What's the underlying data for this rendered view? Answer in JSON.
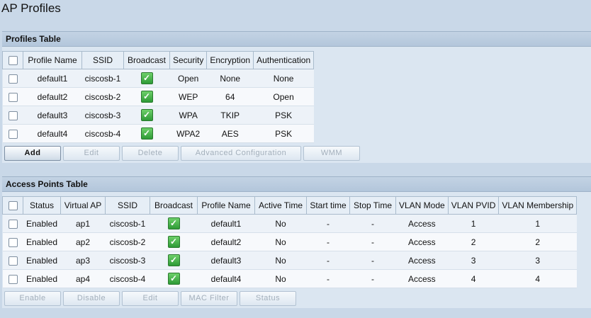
{
  "page_title": "AP Profiles",
  "profiles": {
    "title": "Profiles Table",
    "columns": [
      "Profile Name",
      "SSID",
      "Broadcast",
      "Security",
      "Encryption",
      "Authentication"
    ],
    "rows": [
      {
        "name": "default1",
        "ssid": "ciscosb-1",
        "broadcast": true,
        "security": "Open",
        "encryption": "None",
        "authentication": "None"
      },
      {
        "name": "default2",
        "ssid": "ciscosb-2",
        "broadcast": true,
        "security": "WEP",
        "encryption": "64",
        "authentication": "Open"
      },
      {
        "name": "default3",
        "ssid": "ciscosb-3",
        "broadcast": true,
        "security": "WPA",
        "encryption": "TKIP",
        "authentication": "PSK"
      },
      {
        "name": "default4",
        "ssid": "ciscosb-4",
        "broadcast": true,
        "security": "WPA2",
        "encryption": "AES",
        "authentication": "PSK"
      }
    ],
    "buttons": {
      "add": "Add",
      "edit": "Edit",
      "delete": "Delete",
      "advanced": "Advanced Configuration",
      "wmm": "WMM"
    }
  },
  "access_points": {
    "title": "Access Points Table",
    "columns": [
      "Status",
      "Virtual AP",
      "SSID",
      "Broadcast",
      "Profile Name",
      "Active Time",
      "Start time",
      "Stop Time",
      "VLAN Mode",
      "VLAN PVID",
      "VLAN Membership"
    ],
    "rows": [
      {
        "status": "Enabled",
        "vap": "ap1",
        "ssid": "ciscosb-1",
        "broadcast": true,
        "profile": "default1",
        "active": "No",
        "start": "-",
        "stop": "-",
        "vlan_mode": "Access",
        "pvid": "1",
        "membership": "1"
      },
      {
        "status": "Enabled",
        "vap": "ap2",
        "ssid": "ciscosb-2",
        "broadcast": true,
        "profile": "default2",
        "active": "No",
        "start": "-",
        "stop": "-",
        "vlan_mode": "Access",
        "pvid": "2",
        "membership": "2"
      },
      {
        "status": "Enabled",
        "vap": "ap3",
        "ssid": "ciscosb-3",
        "broadcast": true,
        "profile": "default3",
        "active": "No",
        "start": "-",
        "stop": "-",
        "vlan_mode": "Access",
        "pvid": "3",
        "membership": "3"
      },
      {
        "status": "Enabled",
        "vap": "ap4",
        "ssid": "ciscosb-4",
        "broadcast": true,
        "profile": "default4",
        "active": "No",
        "start": "-",
        "stop": "-",
        "vlan_mode": "Access",
        "pvid": "4",
        "membership": "4"
      }
    ],
    "buttons": {
      "enable": "Enable",
      "disable": "Disable",
      "edit": "Edit",
      "mac_filter": "MAC Filter",
      "status": "Status"
    }
  },
  "icons": {
    "checkmark": "checkmark-icon",
    "checkmark_glyph": "✓"
  },
  "colors": {
    "page_bg": "#c9d8e8",
    "header_bg": "#b3c6db",
    "check_green": "#2e9a36"
  }
}
